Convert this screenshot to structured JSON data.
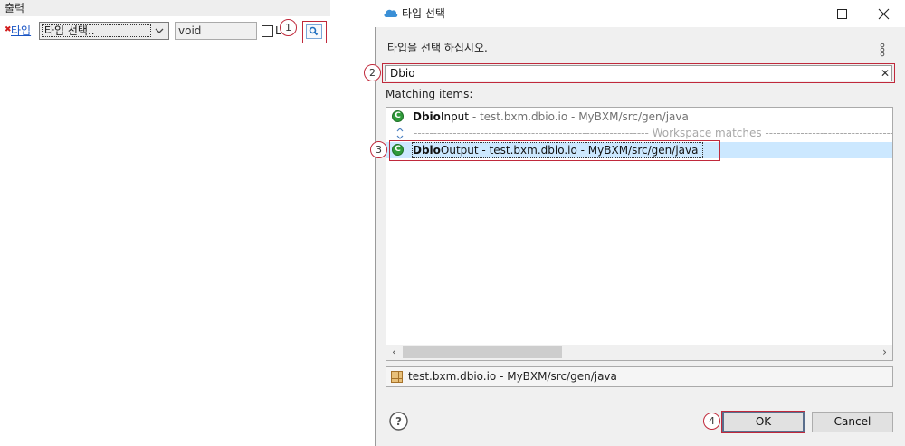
{
  "left_panel": {
    "header": "출력",
    "type_link": "타입",
    "type_select_value": "타입 선택..",
    "return_value": "void",
    "checkbox_label": "L",
    "badge": "1"
  },
  "dialog": {
    "title": "타입 선택",
    "message": "타입을 선택 하십시오.",
    "filter": {
      "value": "Dbio",
      "badge": "2"
    },
    "matching_label": "Matching items:",
    "items": [
      {
        "match": "Dbio",
        "rest": "Input",
        "qualifier": " - test.bxm.dbio.io - MyBXM/src/gen/java"
      },
      {
        "separator": "------------------------------------------------------------ Workspace matches ---------------------------------------------------------------"
      },
      {
        "match": "Dbio",
        "rest": "Output",
        "qualifier": " - test.bxm.dbio.io - MyBXM/src/gen/java",
        "selected": true,
        "badge": "3"
      }
    ],
    "detail": "test.bxm.dbio.io - MyBXM/src/gen/java",
    "buttons": {
      "ok": "OK",
      "cancel": "Cancel",
      "ok_badge": "4"
    }
  },
  "colors": {
    "annotation_red": "#c0293b",
    "selection_blue": "#cce8ff",
    "class_icon_green": "#2f9b3a",
    "link_blue": "#1a55c4"
  },
  "icons": [
    "error-marker-icon",
    "chevron-down-icon",
    "search-icon",
    "cloud-app-icon",
    "minimize-icon",
    "maximize-icon",
    "close-icon",
    "view-menu-icon",
    "clear-icon",
    "class-icon",
    "collapse-icon",
    "package-icon",
    "help-icon"
  ]
}
